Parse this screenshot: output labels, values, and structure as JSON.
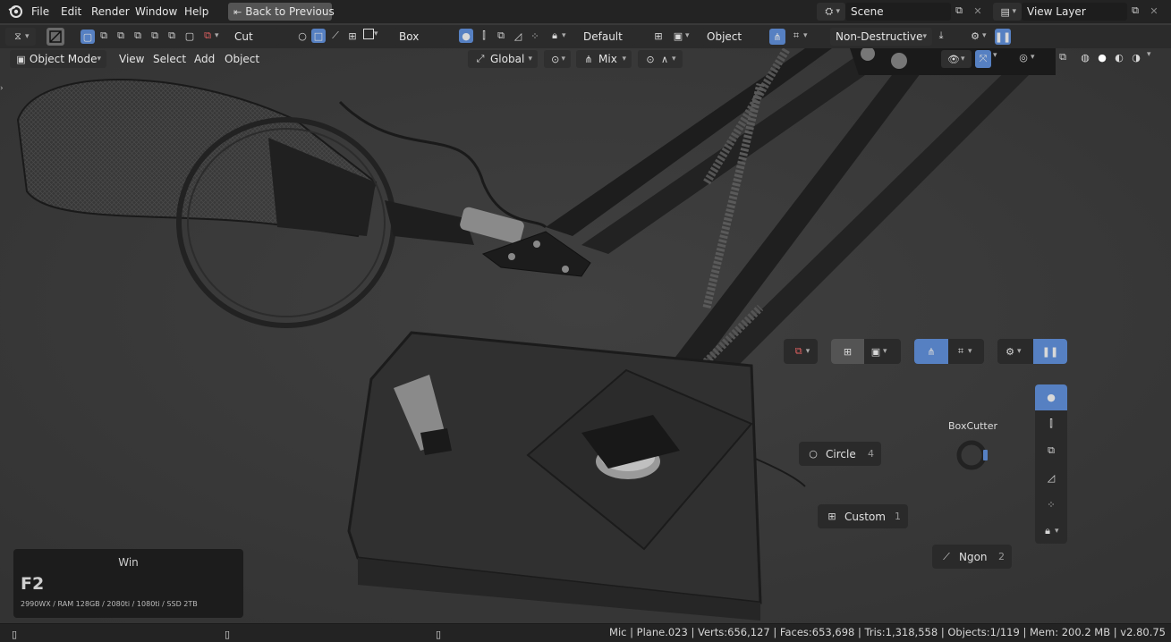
{
  "topbar": {
    "menus": [
      "File",
      "Edit",
      "Render",
      "Window",
      "Help"
    ],
    "back_button": "Back to Previous",
    "scene_field": "Scene",
    "view_layer_field": "View Layer"
  },
  "toolbar": {
    "mode_label": "Cut",
    "shape_label": "Box",
    "default_label": "Default",
    "object_label": "Object",
    "nondestructive_label": "Non-Destructive"
  },
  "header": {
    "mode_select": "Object Mode",
    "menus": [
      "View",
      "Select",
      "Add",
      "Object"
    ],
    "transform_space": "Global",
    "mix_label": "Mix"
  },
  "pie": {
    "title": "BoxCutter",
    "circle": {
      "label": "Circle",
      "key": "4"
    },
    "custom": {
      "label": "Custom",
      "key": "1"
    },
    "ngon": {
      "label": "Ngon",
      "key": "2"
    }
  },
  "overlay": {
    "os": "Win",
    "key": "F2",
    "specs": "2990WX / RAM 128GB / 2080ti / 1080ti / SSD 2TB"
  },
  "status": {
    "text": "Mic | Plane.023 | Verts:656,127 | Faces:653,698 | Tris:1,318,558 | Objects:1/119 | Mem: 200.2 MB | v2.80.75"
  },
  "colors": {
    "accent": "#5680c2",
    "panel": "#1c1c1c",
    "viewport": "#3a3a3a"
  }
}
